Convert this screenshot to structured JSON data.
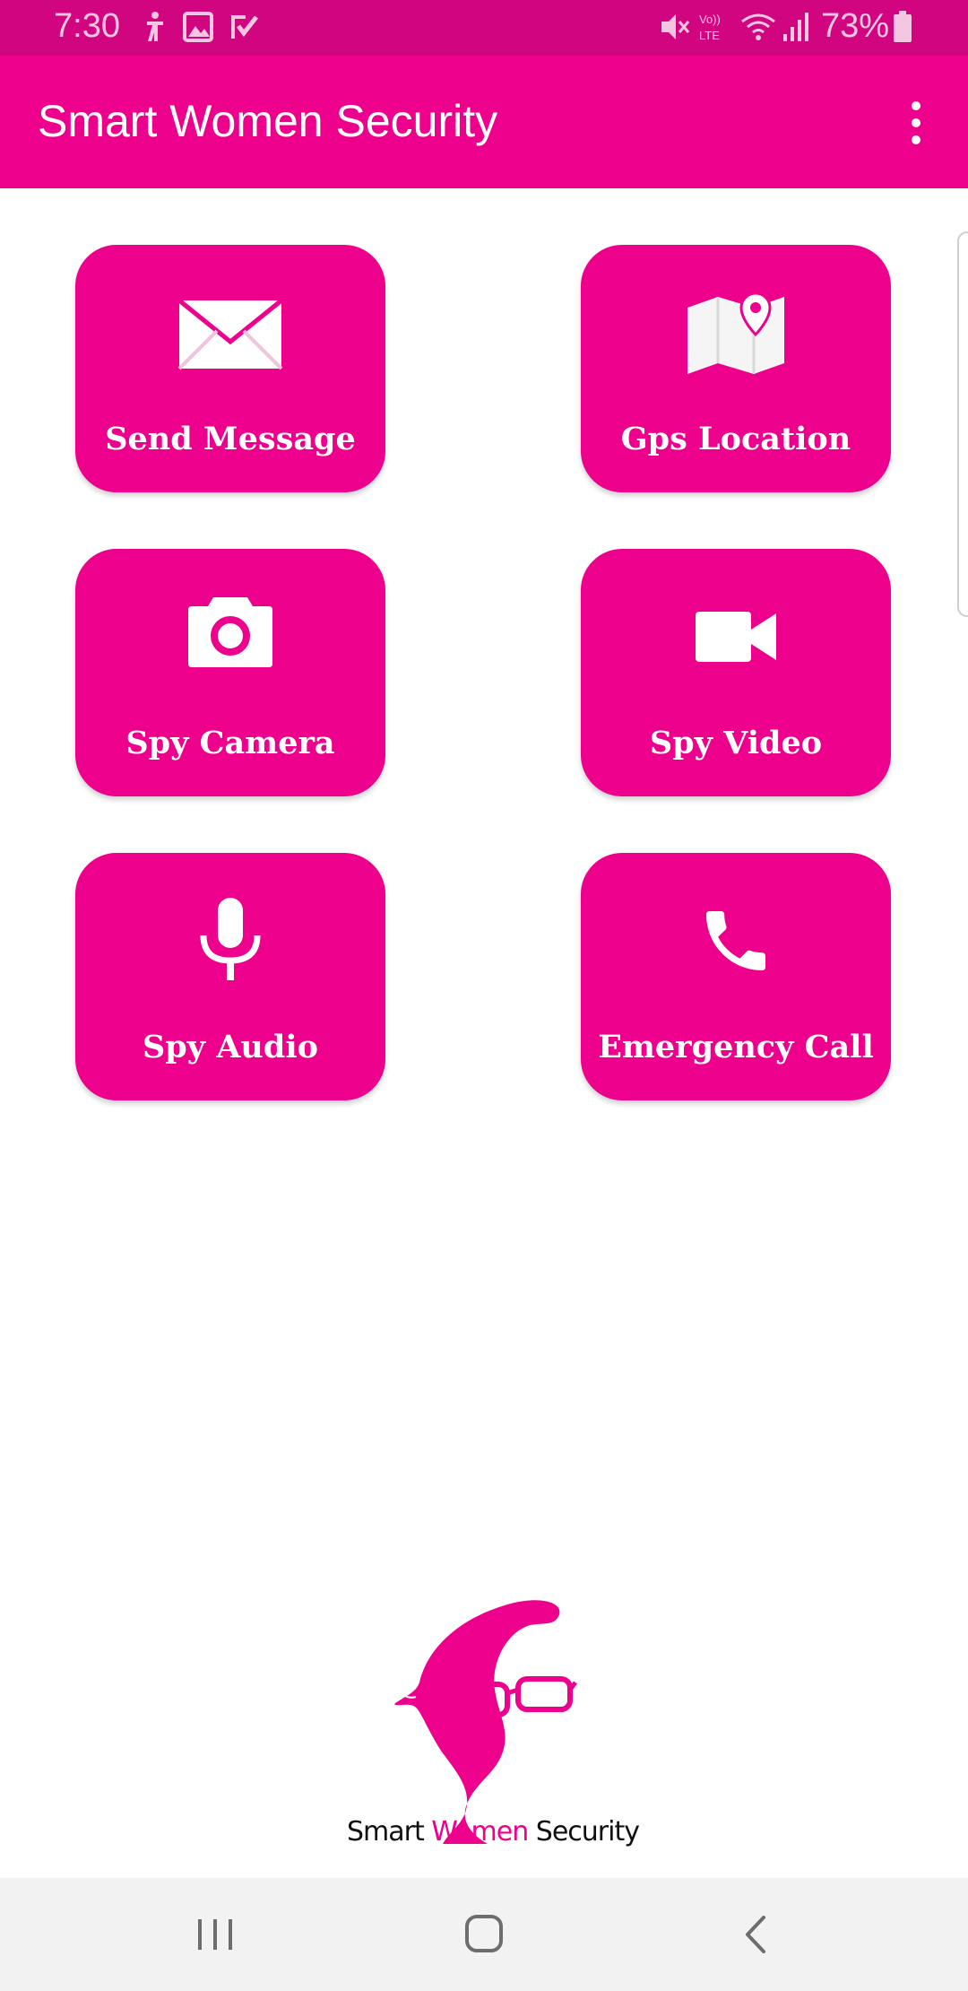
{
  "status_bar": {
    "time": "7:30",
    "battery_percent": "73%",
    "icons": [
      "accessibility-icon",
      "image-icon",
      "check-icon",
      "mute-icon",
      "volte-icon",
      "wifi-icon",
      "signal-icon",
      "battery-icon"
    ]
  },
  "app_bar": {
    "title": "Smart Women Security",
    "menu_icon": "overflow-menu-icon"
  },
  "buttons": [
    {
      "label": "Send Message",
      "icon": "envelope-icon"
    },
    {
      "label": "Gps Location",
      "icon": "map-pin-icon"
    },
    {
      "label": "Spy Camera",
      "icon": "camera-icon"
    },
    {
      "label": "Spy Video",
      "icon": "video-camera-icon"
    },
    {
      "label": "Spy Audio",
      "icon": "microphone-icon"
    },
    {
      "label": "Emergency Call",
      "icon": "phone-icon"
    }
  ],
  "logo": {
    "word1": "Smart",
    "word2": "Women",
    "word3": "Security"
  },
  "nav_bar": {
    "icons": [
      "recent-apps-icon",
      "home-icon",
      "back-icon"
    ]
  },
  "colors": {
    "primary": "#ec008c",
    "status_bar": "#d10580",
    "background": "#ffffff",
    "nav_bar": "#f2f2f2"
  }
}
